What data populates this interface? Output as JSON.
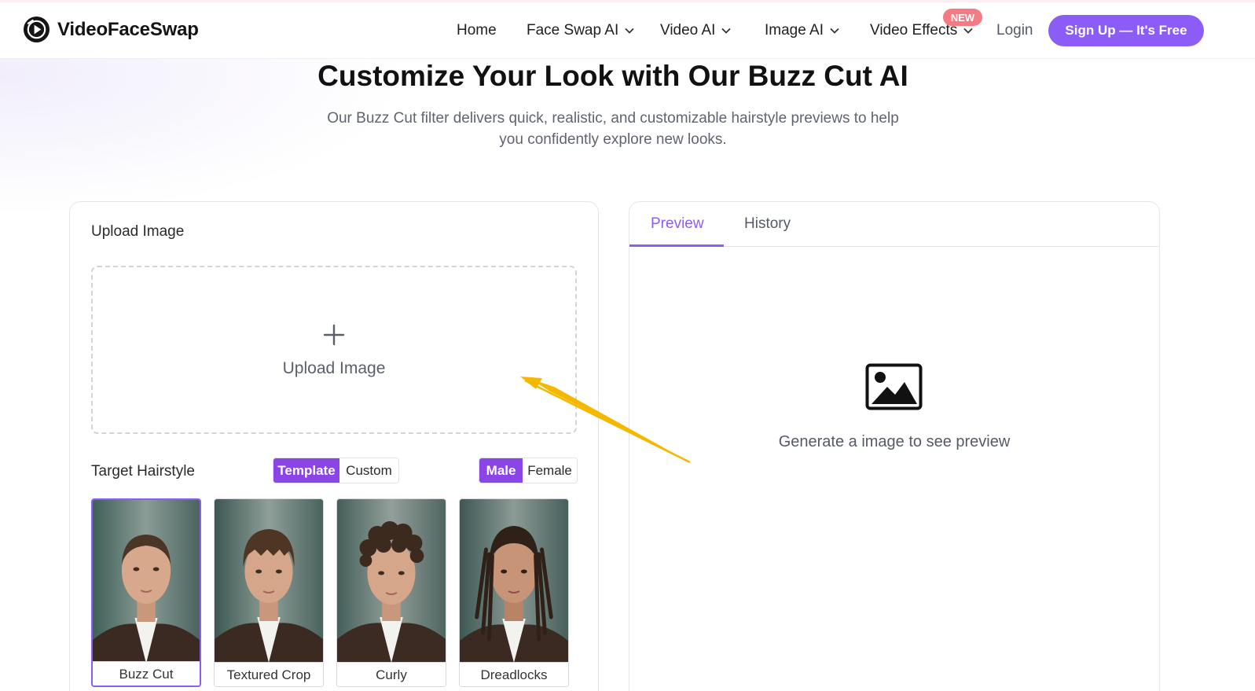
{
  "brand": {
    "name": "VideoFaceSwap"
  },
  "nav": {
    "items": [
      {
        "label": "Home",
        "has_dropdown": false
      },
      {
        "label": "Face Swap AI",
        "has_dropdown": true
      },
      {
        "label": "Video AI",
        "has_dropdown": true
      },
      {
        "label": "Image AI",
        "has_dropdown": true
      },
      {
        "label": "Video Effects",
        "has_dropdown": true,
        "badge": "NEW"
      }
    ],
    "login": "Login",
    "signup": "Sign Up — It's Free"
  },
  "hero": {
    "title": "Customize Your Look with Our Buzz Cut AI",
    "subtitle": "Our Buzz Cut filter delivers quick, realistic, and customizable hairstyle previews to help you confidently explore new looks."
  },
  "upload": {
    "section_label": "Upload Image",
    "dropzone_label": "Upload Image"
  },
  "hairstyle": {
    "label": "Target Hairstyle",
    "mode_options": [
      "Template",
      "Custom"
    ],
    "mode_selected": "Template",
    "gender_options": [
      "Male",
      "Female"
    ],
    "gender_selected": "Male",
    "templates": [
      {
        "label": "Buzz Cut",
        "selected": true
      },
      {
        "label": "Textured Crop",
        "selected": false
      },
      {
        "label": "Curly",
        "selected": false
      },
      {
        "label": "Dreadlocks",
        "selected": false
      }
    ]
  },
  "preview": {
    "tabs": [
      "Preview",
      "History"
    ],
    "active_tab": "Preview",
    "empty_message": "Generate a image to see preview"
  },
  "colors": {
    "accent": "#8b5cf6",
    "accent_dark": "#8b45e6",
    "badge": "#f47b83",
    "arrow": "#f5b800"
  },
  "icons": [
    "brand-logo-icon",
    "chevron-down-icon",
    "plus-icon",
    "image-placeholder-icon"
  ]
}
